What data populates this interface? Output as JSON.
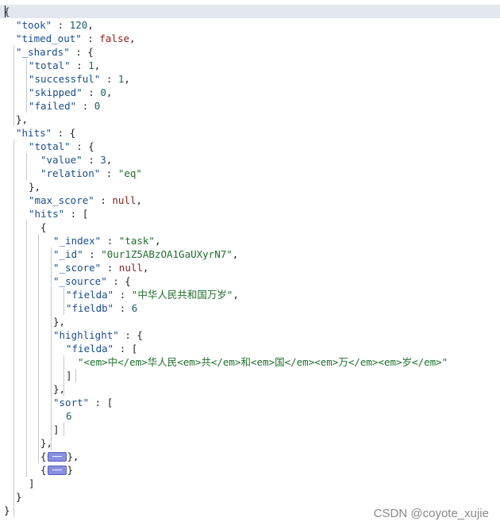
{
  "json_tree": {
    "lines": [
      {
        "id": "brace-open-root",
        "parts": [
          {
            "t": "{",
            "c": "p"
          }
        ]
      },
      {
        "id": "took",
        "parts": [
          {
            "t": "\"took\"",
            "c": "key"
          },
          {
            "t": " : ",
            "c": "p"
          },
          {
            "t": "120",
            "c": "num"
          },
          {
            "t": ",",
            "c": "p"
          }
        ]
      },
      {
        "id": "timed-out",
        "parts": [
          {
            "t": "\"timed_out\"",
            "c": "key"
          },
          {
            "t": " : ",
            "c": "p"
          },
          {
            "t": "false",
            "c": "kw"
          },
          {
            "t": ",",
            "c": "p"
          }
        ]
      },
      {
        "id": "shards",
        "parts": [
          {
            "t": "\"_shards\"",
            "c": "key"
          },
          {
            "t": " : {",
            "c": "p"
          }
        ]
      },
      {
        "id": "shards-total",
        "parts": [
          {
            "t": "\"total\"",
            "c": "key"
          },
          {
            "t": " : ",
            "c": "p"
          },
          {
            "t": "1",
            "c": "num"
          },
          {
            "t": ",",
            "c": "p"
          }
        ]
      },
      {
        "id": "shards-successful",
        "parts": [
          {
            "t": "\"successful\"",
            "c": "key"
          },
          {
            "t": " : ",
            "c": "p"
          },
          {
            "t": "1",
            "c": "num"
          },
          {
            "t": ",",
            "c": "p"
          }
        ]
      },
      {
        "id": "shards-skipped",
        "parts": [
          {
            "t": "\"skipped\"",
            "c": "key"
          },
          {
            "t": " : ",
            "c": "p"
          },
          {
            "t": "0",
            "c": "num"
          },
          {
            "t": ",",
            "c": "p"
          }
        ]
      },
      {
        "id": "shards-failed",
        "parts": [
          {
            "t": "\"failed\"",
            "c": "key"
          },
          {
            "t": " : ",
            "c": "p"
          },
          {
            "t": "0",
            "c": "num"
          }
        ]
      },
      {
        "id": "shards-close",
        "parts": [
          {
            "t": "},",
            "c": "p"
          }
        ]
      },
      {
        "id": "hits",
        "parts": [
          {
            "t": "\"hits\"",
            "c": "key"
          },
          {
            "t": " : {",
            "c": "p"
          }
        ]
      },
      {
        "id": "hits-total",
        "parts": [
          {
            "t": "\"total\"",
            "c": "key"
          },
          {
            "t": " : {",
            "c": "p"
          }
        ]
      },
      {
        "id": "hits-total-value",
        "parts": [
          {
            "t": "\"value\"",
            "c": "key"
          },
          {
            "t": " : ",
            "c": "p"
          },
          {
            "t": "3",
            "c": "num"
          },
          {
            "t": ",",
            "c": "p"
          }
        ]
      },
      {
        "id": "hits-total-relation",
        "parts": [
          {
            "t": "\"relation\"",
            "c": "key"
          },
          {
            "t": " : ",
            "c": "p"
          },
          {
            "t": "\"eq\"",
            "c": "str"
          }
        ]
      },
      {
        "id": "hits-total-close",
        "parts": [
          {
            "t": "},",
            "c": "p"
          }
        ]
      },
      {
        "id": "max-score",
        "parts": [
          {
            "t": "\"max_score\"",
            "c": "key"
          },
          {
            "t": " : ",
            "c": "p"
          },
          {
            "t": "null",
            "c": "kw"
          },
          {
            "t": ",",
            "c": "p"
          }
        ]
      },
      {
        "id": "hits-array",
        "parts": [
          {
            "t": "\"hits\"",
            "c": "key"
          },
          {
            "t": " : [",
            "c": "p"
          }
        ]
      },
      {
        "id": "hit-0-open",
        "parts": [
          {
            "t": "{",
            "c": "p"
          }
        ]
      },
      {
        "id": "hit-0-index",
        "parts": [
          {
            "t": "\"_index\"",
            "c": "key"
          },
          {
            "t": " : ",
            "c": "p"
          },
          {
            "t": "\"task\"",
            "c": "str"
          },
          {
            "t": ",",
            "c": "p"
          }
        ]
      },
      {
        "id": "hit-0-id",
        "parts": [
          {
            "t": "\"_id\"",
            "c": "key"
          },
          {
            "t": " : ",
            "c": "p"
          },
          {
            "t": "\"0ur1Z5ABzOA1GaUXyrN7\"",
            "c": "str"
          },
          {
            "t": ",",
            "c": "p"
          }
        ]
      },
      {
        "id": "hit-0-score",
        "parts": [
          {
            "t": "\"_score\"",
            "c": "key"
          },
          {
            "t": " : ",
            "c": "p"
          },
          {
            "t": "null",
            "c": "kw"
          },
          {
            "t": ",",
            "c": "p"
          }
        ]
      },
      {
        "id": "hit-0-source",
        "parts": [
          {
            "t": "\"_source\"",
            "c": "key"
          },
          {
            "t": " : {",
            "c": "p"
          }
        ]
      },
      {
        "id": "hit-0-fielda",
        "parts": [
          {
            "t": "\"fielda\"",
            "c": "key"
          },
          {
            "t": " : ",
            "c": "p"
          },
          {
            "t": "\"中华人民共和国万岁\"",
            "c": "str"
          },
          {
            "t": ",",
            "c": "p"
          }
        ]
      },
      {
        "id": "hit-0-fieldb",
        "parts": [
          {
            "t": "\"fieldb\"",
            "c": "key"
          },
          {
            "t": " : ",
            "c": "p"
          },
          {
            "t": "6",
            "c": "num"
          }
        ]
      },
      {
        "id": "hit-0-source-close",
        "parts": [
          {
            "t": "},",
            "c": "p"
          }
        ]
      },
      {
        "id": "hit-0-highlight",
        "parts": [
          {
            "t": "\"highlight\"",
            "c": "key"
          },
          {
            "t": " : {",
            "c": "p"
          }
        ]
      },
      {
        "id": "hit-0-hl-fielda",
        "parts": [
          {
            "t": "\"fielda\"",
            "c": "key"
          },
          {
            "t": " : [",
            "c": "p"
          }
        ]
      },
      {
        "id": "hit-0-hl-value",
        "parts": [
          {
            "t": "\"<em>中</em>华人民<em>共</em>和<em>国</em><em>万</em><em>岁</em>\"",
            "c": "str"
          }
        ]
      },
      {
        "id": "hit-0-hl-fielda-close",
        "parts": [
          {
            "t": "]",
            "c": "p"
          }
        ]
      },
      {
        "id": "hit-0-highlight-close",
        "parts": [
          {
            "t": "},",
            "c": "p"
          }
        ]
      },
      {
        "id": "hit-0-sort",
        "parts": [
          {
            "t": "\"sort\"",
            "c": "key"
          },
          {
            "t": " : [",
            "c": "p"
          }
        ]
      },
      {
        "id": "hit-0-sort-value",
        "parts": [
          {
            "t": "6",
            "c": "num"
          }
        ]
      },
      {
        "id": "hit-0-sort-close",
        "parts": [
          {
            "t": "]",
            "c": "p"
          }
        ]
      },
      {
        "id": "hit-0-close",
        "parts": [
          {
            "t": "},",
            "c": "p"
          }
        ]
      },
      {
        "id": "hit-1-collapsed",
        "parts": [
          {
            "t": "{",
            "c": "p"
          },
          {
            "collapsed": true
          },
          {
            "t": "},",
            "c": "p"
          }
        ]
      },
      {
        "id": "hit-2-collapsed",
        "parts": [
          {
            "t": "{",
            "c": "p"
          },
          {
            "collapsed": true
          },
          {
            "t": "}",
            "c": "p"
          }
        ]
      },
      {
        "id": "hits-array-close",
        "parts": [
          {
            "t": "]",
            "c": "p"
          }
        ]
      },
      {
        "id": "hits-close",
        "parts": [
          {
            "t": "}",
            "c": "p"
          }
        ]
      },
      {
        "id": "brace-close-root",
        "parts": [
          {
            "t": "}",
            "c": "p"
          }
        ]
      }
    ]
  },
  "watermark": "CSDN @coyote_xujie"
}
